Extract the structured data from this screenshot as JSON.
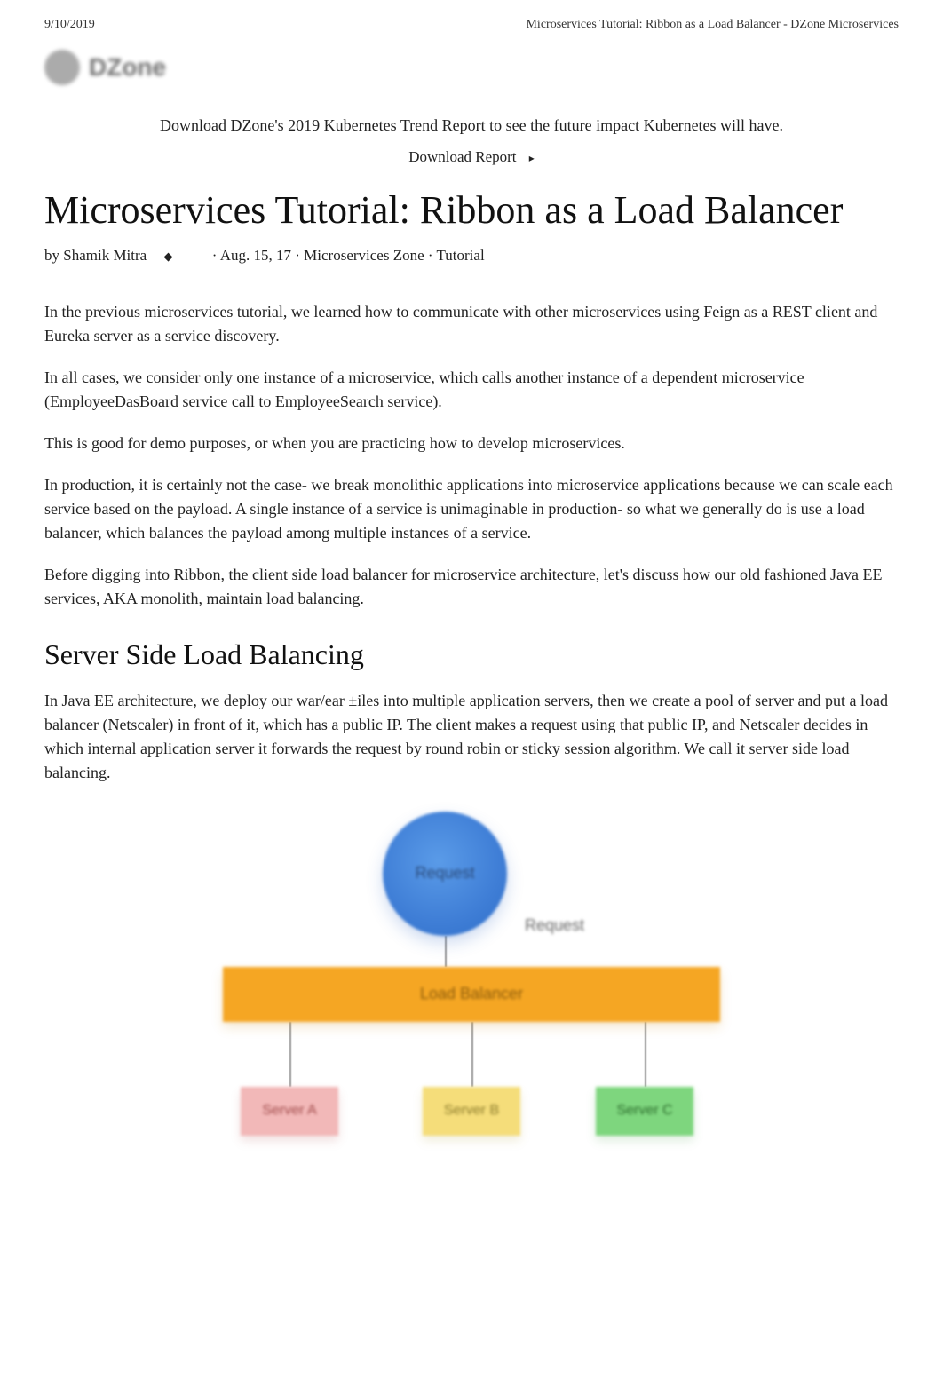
{
  "meta": {
    "date": "9/10/2019",
    "page_header": "Microservices Tutorial: Ribbon as a Load Balancer - DZone Microservices"
  },
  "logo": {
    "text": "DZone"
  },
  "promo": {
    "text": "Download DZone's 2019 Kubernetes Trend Report to see the future impact Kubernetes will have.",
    "cta": "Download Report"
  },
  "article": {
    "title": "Microservices Tutorial: Ribbon as a Load Balancer",
    "byline_prefix": "by ",
    "author": "Shamik Mitra",
    "separator1": " · ",
    "date": "Aug. 15, 17",
    "separator2": " · ",
    "zone": "Microservices Zone",
    "separator3": " · ",
    "type": "Tutorial"
  },
  "body": {
    "p1": "In the previous microservices tutorial, we learned how to communicate with other microservices using Feign as a REST client and Eureka server as a service discovery.",
    "p2": "In all cases, we consider only one instance of a microservice, which calls another instance of a dependent microservice (EmployeeDasBoard service call to EmployeeSearch service).",
    "p3": "This is good for demo purposes, or when you are practicing how to develop microservices.",
    "p4": "In production, it is certainly not the case- we break monolithic applications into microservice applications because we can scale each service based on the payload. A single instance of a service is unimaginable in production- so what we generally do is use a load balancer, which balances the payload among multiple instances of a service.",
    "p5": "Before digging into Ribbon, the client side load balancer for microservice architecture, let's discuss how our old fashioned Java EE services, AKA monolith, maintain load balancing.",
    "h2_1": "Server Side Load Balancing",
    "p6": "In Java EE architecture, we deploy our war/ear ±iles into multiple application servers, then we create a pool of server and put a load balancer (Netscaler) in front of it, which has a public IP. The client makes a request using that public IP, and Netscaler decides in which internal application server it forwards the request by round robin or sticky session algorithm. We call it server side load balancing."
  },
  "diagram": {
    "request_node": "Request",
    "request_label": "Request",
    "load_balancer": "Load Balancer",
    "server1": "Server A",
    "server2": "Server B",
    "server3": "Server C"
  }
}
